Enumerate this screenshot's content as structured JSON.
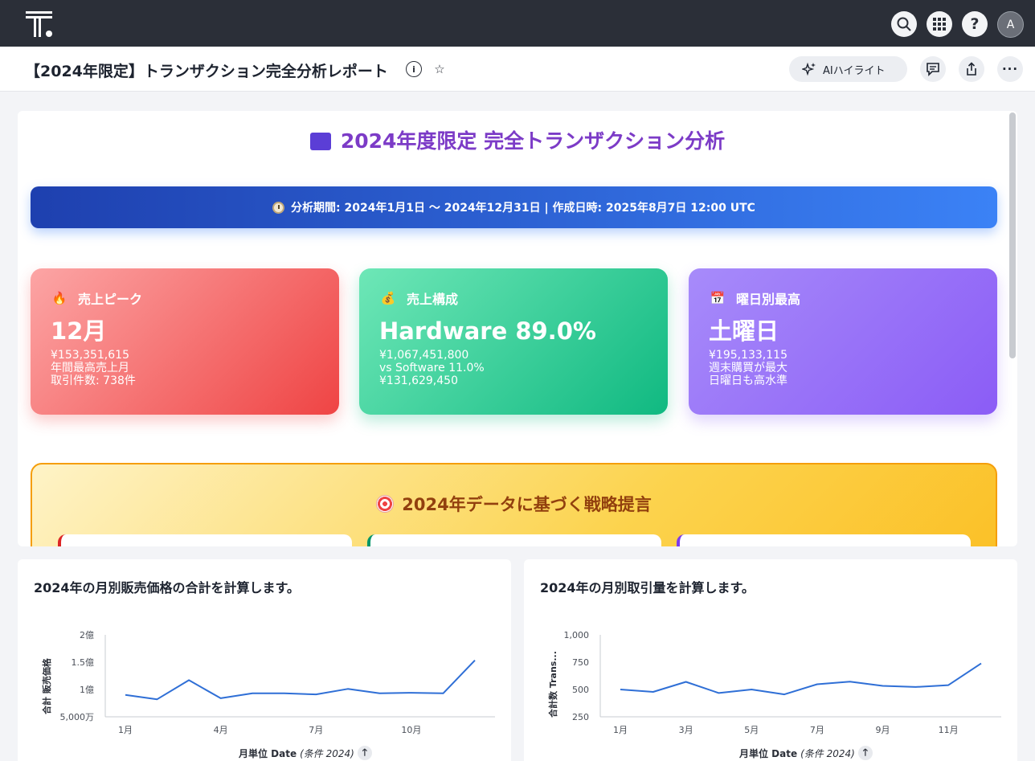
{
  "topbar": {
    "icons": [
      "search-icon",
      "apps-grid-icon",
      "help-icon"
    ],
    "avatar_initial": "A"
  },
  "titlebar": {
    "title": "【2024年限定】トランザクション完全分析レポート",
    "ai_button_label": "AIハイライト",
    "icons": [
      "info-icon",
      "star-icon",
      "comment-icon",
      "share-icon",
      "more-icon"
    ]
  },
  "report": {
    "heading": "2024年度限定 完全トランザクション分析",
    "period": "分析期間: 2024年1月1日 〜 2024年12月31日 | 作成日時: 2025年8月7日 12:00 UTC",
    "kpis": [
      {
        "label": "売上ピーク",
        "emoji": "🔥",
        "value": "12月",
        "lines": [
          "¥153,351,615",
          "年間最高売上月",
          "取引件数: 738件"
        ],
        "color": "#ef4444"
      },
      {
        "label": "売上構成",
        "emoji": "💰",
        "value": "Hardware 89.0%",
        "lines": [
          "¥1,067,451,800",
          "vs Software 11.0%",
          "¥131,629,450"
        ],
        "color": "#10b981"
      },
      {
        "label": "曜日別最高",
        "emoji": "📅",
        "value": "土曜日",
        "lines": [
          "¥195,133,115",
          "週末購買が最大",
          "日曜日も高水準"
        ],
        "color": "#8b5cf6"
      }
    ],
    "strategy_title": "2024年データに基づく戦略提言",
    "strategy_card_colors": [
      "#dc2626",
      "#059669",
      "#7c3aed"
    ]
  },
  "charts": [
    {
      "title": "2024年の月別販売価格の合計を計算します。",
      "y_label": "合計 販売価格",
      "x_label": "月単位 Date",
      "x_label_note": "(条件 2024)",
      "y_ticks": [
        "2億",
        "1.5億",
        "1億",
        "5,000万"
      ],
      "x_ticks": [
        "1月",
        "4月",
        "7月",
        "10月"
      ]
    },
    {
      "title": "2024年の月別取引量を計算します。",
      "y_label": "合計数 Trans...",
      "x_label": "月単位 Date",
      "x_label_note": "(条件 2024)",
      "y_ticks": [
        "1,000",
        "750",
        "500",
        "250"
      ],
      "x_ticks": [
        "1月",
        "3月",
        "5月",
        "7月",
        "9月",
        "11月"
      ]
    }
  ],
  "chart_data": [
    {
      "type": "line",
      "title": "2024年の月別販売価格の合計を計算します。",
      "xlabel": "月単位 Date (条件 2024)",
      "ylabel": "合計 販売価格",
      "x": [
        "1月",
        "2月",
        "3月",
        "4月",
        "5月",
        "6月",
        "7月",
        "8月",
        "9月",
        "10月",
        "11月",
        "12月"
      ],
      "values": [
        90000000,
        82000000,
        117000000,
        84000000,
        93000000,
        93000000,
        91000000,
        101000000,
        93000000,
        94000000,
        93000000,
        153351615
      ],
      "ylim": [
        50000000,
        200000000
      ],
      "color": "#2f6fd6"
    },
    {
      "type": "line",
      "title": "2024年の月別取引量を計算します。",
      "xlabel": "月単位 Date (条件 2024)",
      "ylabel": "合計数 Trans...",
      "x": [
        "1月",
        "2月",
        "3月",
        "4月",
        "5月",
        "6月",
        "7月",
        "8月",
        "9月",
        "10月",
        "11月",
        "12月"
      ],
      "values": [
        500,
        478,
        570,
        468,
        500,
        455,
        548,
        572,
        533,
        523,
        540,
        738
      ],
      "ylim": [
        250,
        1000
      ],
      "color": "#2f6fd6"
    }
  ]
}
